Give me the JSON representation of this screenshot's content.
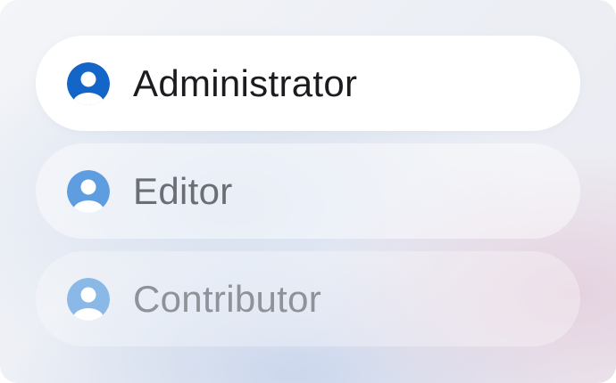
{
  "roles": [
    {
      "label": "Administrator",
      "state": "selected",
      "icon": "user-avatar-icon",
      "icon_color": "#1465c8",
      "text_color": "#1a1c20"
    },
    {
      "label": "Editor",
      "state": "default",
      "icon": "user-avatar-icon",
      "icon_color": "#5e9de0",
      "text_color": "#6b6e74"
    },
    {
      "label": "Contributor",
      "state": "default",
      "icon": "user-avatar-icon",
      "icon_color": "#8ab9e8",
      "text_color": "#8f9298"
    }
  ]
}
